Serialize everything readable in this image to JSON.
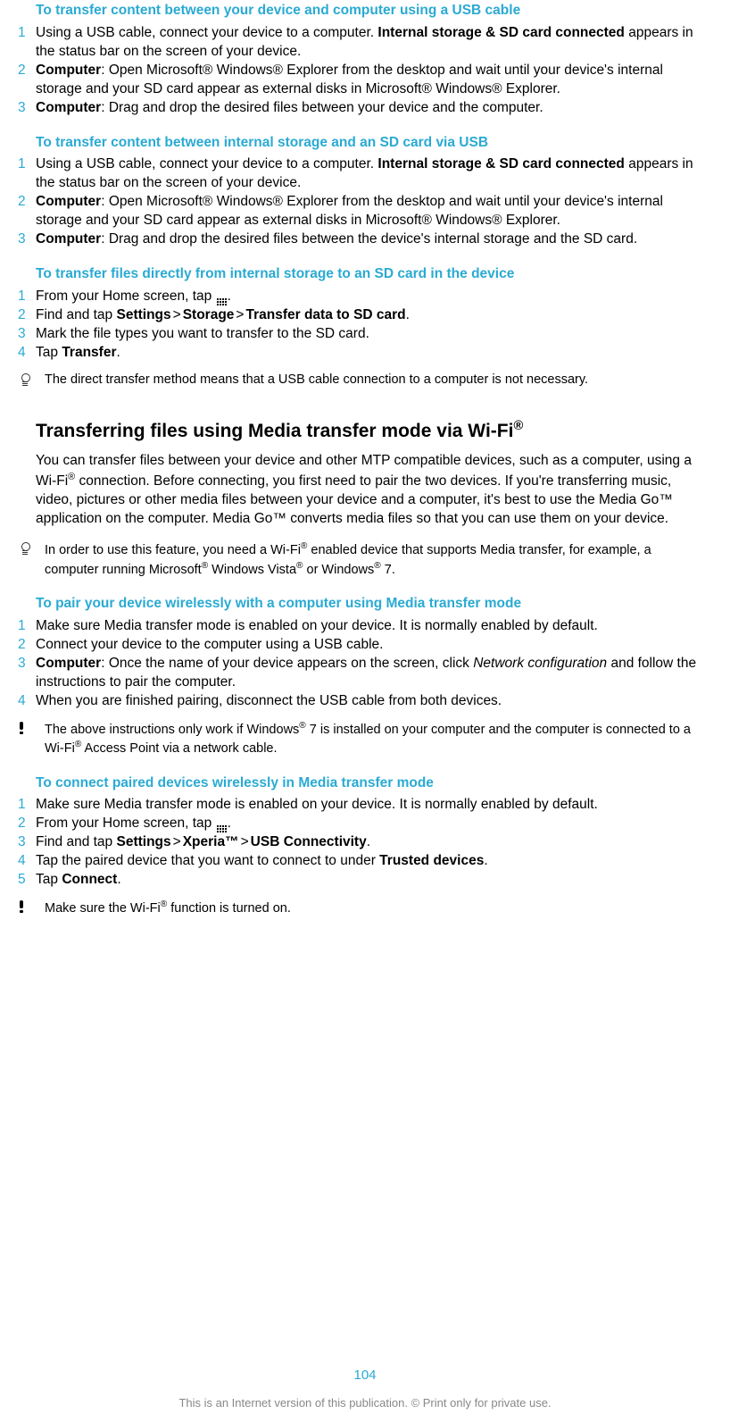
{
  "page_number": "104",
  "footer": "This is an Internet version of this publication. © Print only for private use.",
  "sec1": {
    "title": "To transfer content between your device and computer using a USB cable",
    "s1a": "Using a USB cable, connect your device to a computer. ",
    "s1b": "Internal storage & SD card connected",
    "s1c": " appears in the status bar on the screen of your device.",
    "s2a": "Computer",
    "s2b": ": Open Microsoft® Windows® Explorer from the desktop and wait until your device's internal storage and your SD card appear as external disks in Microsoft® Windows® Explorer.",
    "s3a": "Computer",
    "s3b": ": Drag and drop the desired files between your device and the computer."
  },
  "sec2": {
    "title": "To transfer content between internal storage and an SD card via USB",
    "s1a": "Using a USB cable, connect your device to a computer. ",
    "s1b": "Internal storage & SD card connected",
    "s1c": " appears in the status bar on the screen of your device.",
    "s2a": "Computer",
    "s2b": ": Open Microsoft® Windows® Explorer from the desktop and wait until your device's internal storage and your SD card appear as external disks in Microsoft® Windows® Explorer.",
    "s3a": "Computer",
    "s3b": ": Drag and drop the desired files between the device's internal storage and the SD card."
  },
  "sec3": {
    "title": "To transfer files directly from internal storage to an SD card in the device",
    "s1": "From your Home screen, tap ",
    "s1end": ".",
    "s2a": "Find and tap ",
    "s2b": "Settings",
    "s2c": "Storage",
    "s2d": "Transfer data to SD card",
    "s2e": ".",
    "s3": "Mark the file types you want to transfer to the SD card.",
    "s4a": "Tap ",
    "s4b": "Transfer",
    "s4c": ".",
    "note": "The direct transfer method means that a USB cable connection to a computer is not necessary."
  },
  "sec4": {
    "heading_a": "Transferring files using Media transfer mode via Wi-Fi",
    "heading_sup": "®",
    "para_a": "You can transfer files between your device and other MTP compatible devices, such as a computer, using a Wi-Fi",
    "para_b": " connection. Before connecting, you first need to pair the two devices. If you're transferring music, video, pictures or other media files between your device and a computer, it's best to use the Media Go™ application on the computer. Media Go™ converts media files so that you can use them on your device.",
    "note_a": "In order to use this feature, you need a Wi-Fi",
    "note_b": " enabled device that supports Media transfer, for example, a computer running Microsoft",
    "note_c": " Windows Vista",
    "note_d": " or Windows",
    "note_e": " 7."
  },
  "sec5": {
    "title": "To pair your device wirelessly with a computer using Media transfer mode",
    "s1": "Make sure Media transfer mode is enabled on your device. It is normally enabled by default.",
    "s2": "Connect your device to the computer using a USB cable.",
    "s3a": "Computer",
    "s3b": ": Once the name of your device appears on the screen, click ",
    "s3c": "Network configuration",
    "s3d": " and follow the instructions to pair the computer.",
    "s4": "When you are finished pairing, disconnect the USB cable from both devices.",
    "note_a": "The above instructions only work if Windows",
    "note_b": " 7 is installed on your computer and the computer is connected to a Wi-Fi",
    "note_c": " Access Point via a network cable."
  },
  "sec6": {
    "title": "To connect paired devices wirelessly in Media transfer mode",
    "s1": "Make sure Media transfer mode is enabled on your device. It is normally enabled by default.",
    "s2": "From your Home screen, tap ",
    "s2end": ".",
    "s3a": "Find and tap ",
    "s3b": "Settings",
    "s3c": "Xperia™",
    "s3d": "USB Connectivity",
    "s3e": ".",
    "s4a": "Tap the paired device that you want to connect to under ",
    "s4b": "Trusted devices",
    "s4c": ".",
    "s5a": "Tap ",
    "s5b": "Connect",
    "s5c": ".",
    "note_a": "Make sure the Wi-Fi",
    "note_b": " function is turned on."
  },
  "gt": ">"
}
